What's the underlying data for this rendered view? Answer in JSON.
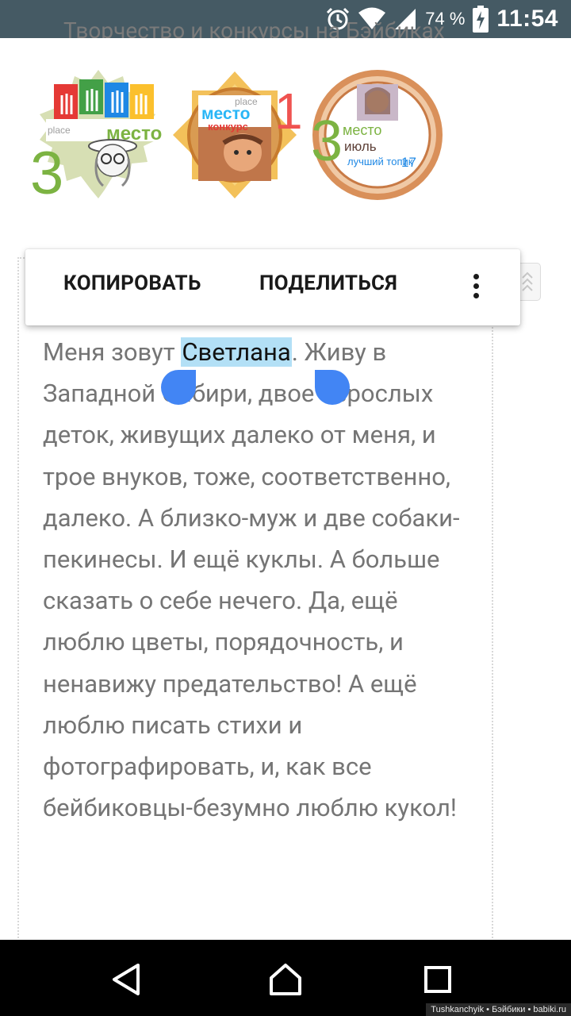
{
  "status_bar": {
    "battery_percent": "74 %",
    "time": "11:54",
    "icons": [
      "alarm-icon",
      "wifi-icon",
      "cell-signal-icon",
      "battery-charging-icon"
    ]
  },
  "page": {
    "top_cut_text": "Творчество и конкурсы на Бэйбиках"
  },
  "badges": [
    {
      "rank": "3",
      "place_label": "place",
      "title": "место"
    },
    {
      "rank": "1",
      "place_label": "place",
      "title": "место",
      "subtitle": "конкурс"
    },
    {
      "rank": "3",
      "title": "место",
      "month": "июль",
      "caption": "лучший топик",
      "year": "17"
    }
  ],
  "context_menu": {
    "copy_label": "КОПИРОВАТЬ",
    "share_label": "ПОДЕЛИТЬСЯ",
    "more_icon": "more-vert-icon"
  },
  "content": {
    "text_before_selection": "Меня зовут ",
    "selected_text": "Светлана",
    "text_after_selection": ". Живу в Западной Сибири, двое взрослых деток, живущих далеко от меня, и трое внуков, тоже, соответственно, далеко. А близко-муж и две собаки-пекинесы. И ещё куклы. А больше сказать о себе нечего. Да, ещё люблю цветы, порядочность, и ненавижу предательство! А ещё люблю писать стихи и фотографировать, и, как все бейбиковцы-безумно люблю кукол!"
  },
  "nav_bar": {
    "back_icon": "back-triangle-icon",
    "home_icon": "home-icon",
    "recents_icon": "recents-square-icon"
  },
  "watermark": "Tushkanchyik • Бэйбики • babiki.ru",
  "colors": {
    "status_bar": "#455a64",
    "selection_bg": "#b3e0f6",
    "handle": "#4285f4",
    "body_text": "#757575"
  }
}
